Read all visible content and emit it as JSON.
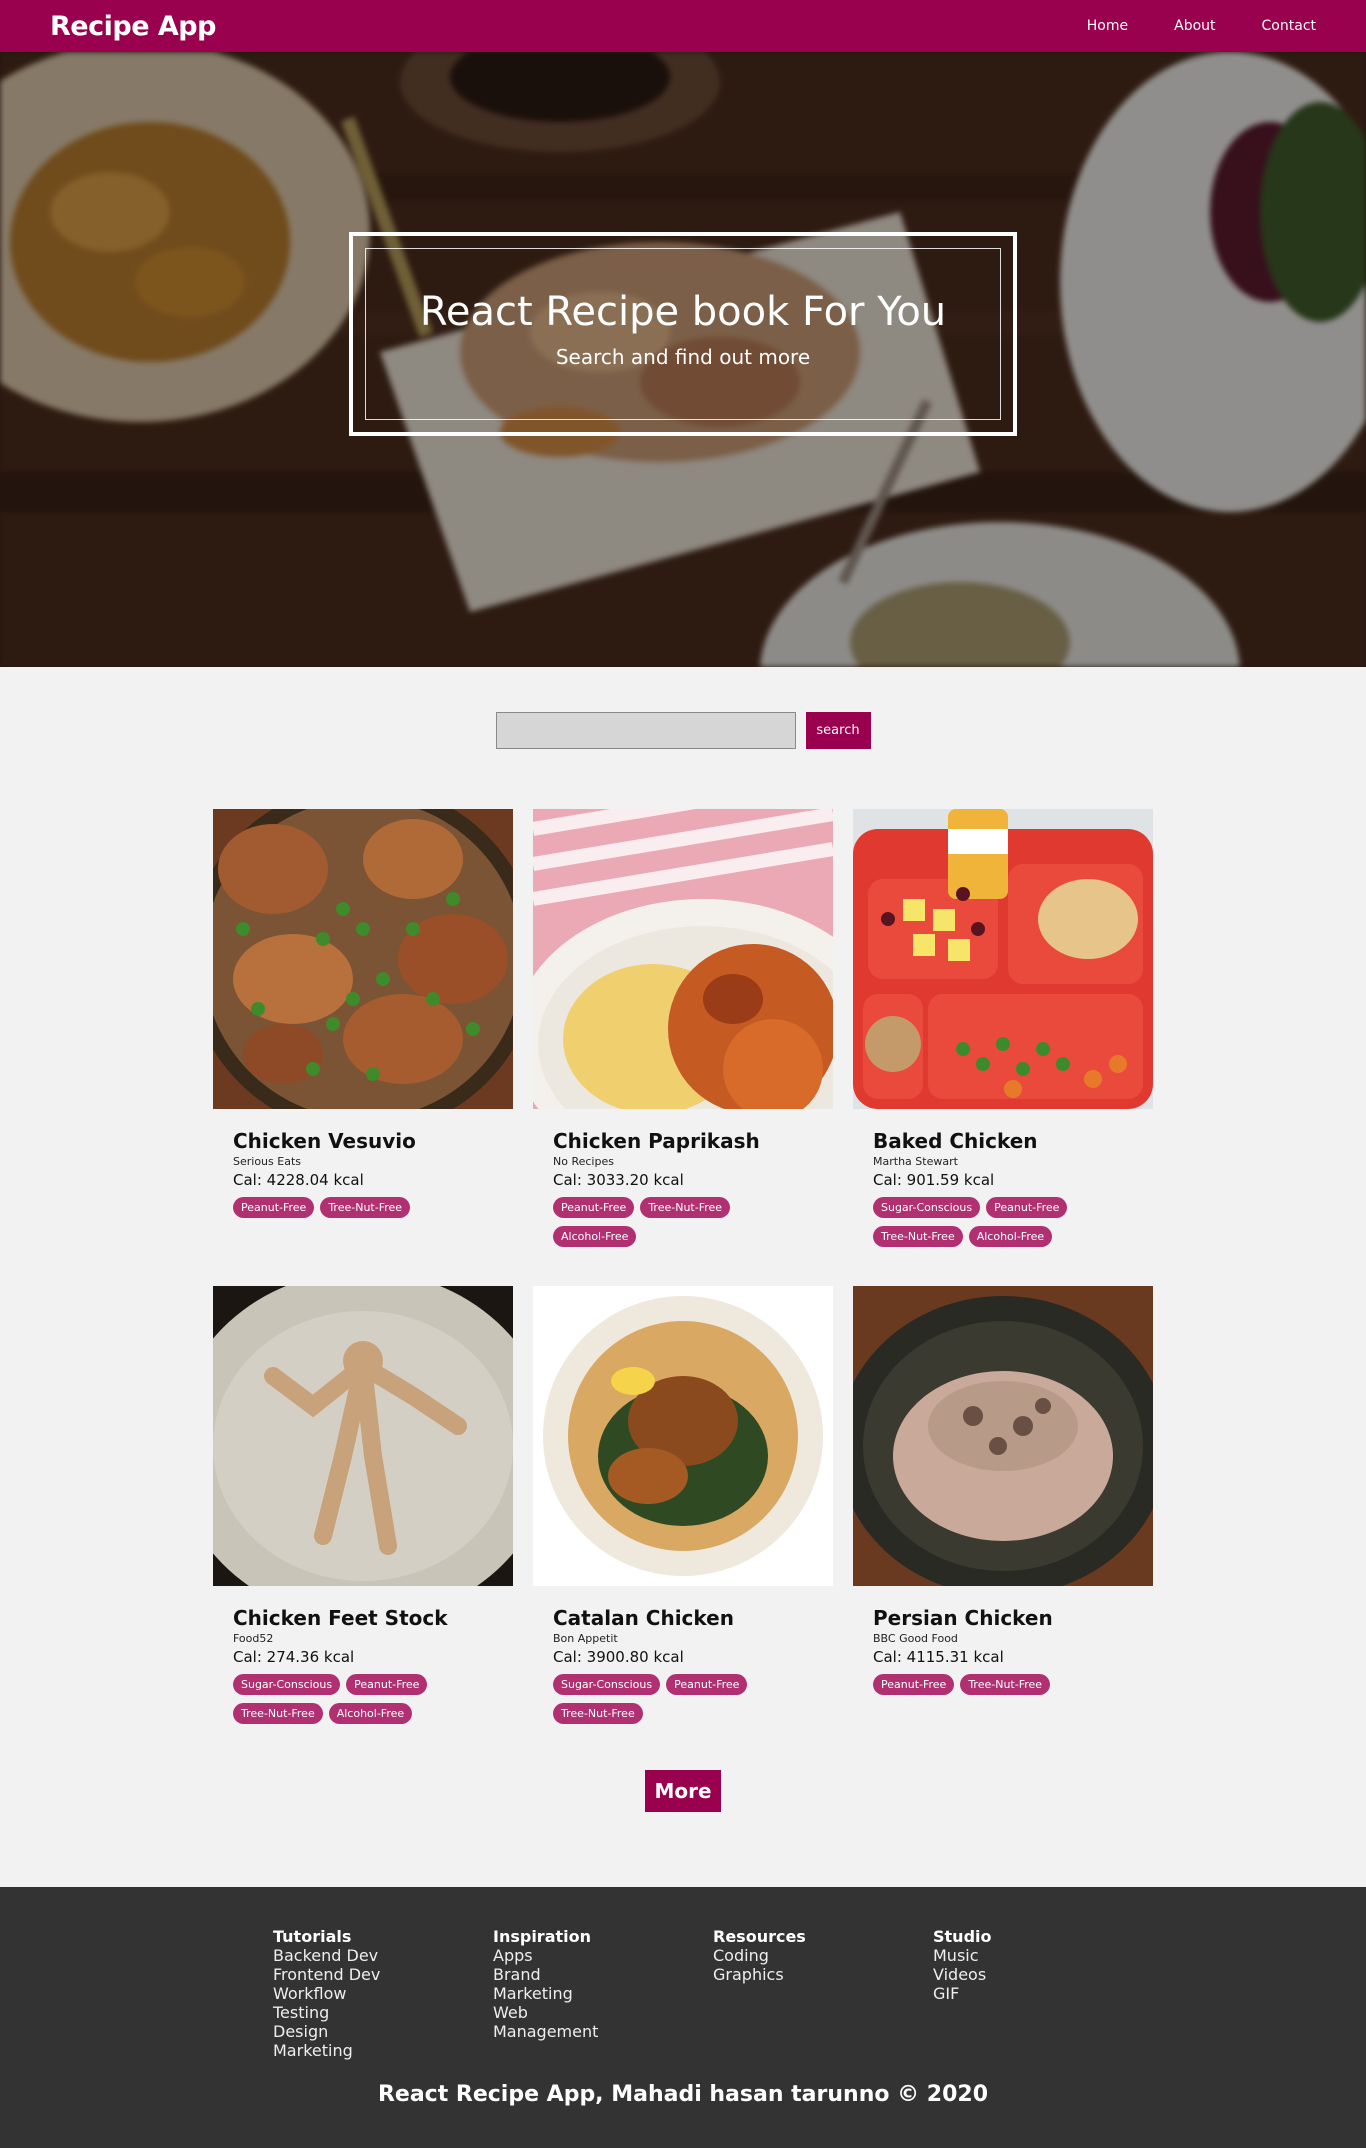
{
  "nav": {
    "brand": "Recipe App",
    "links": [
      "Home",
      "About",
      "Contact"
    ]
  },
  "hero": {
    "title": "React Recipe book For You",
    "subtitle": "Search and find out more"
  },
  "search": {
    "value": "",
    "placeholder": "",
    "button_label": "search"
  },
  "recipes": [
    {
      "title": "Chicken Vesuvio",
      "source": "Serious Eats",
      "calories": "Cal: 4228.04 kcal",
      "tags": [
        "Peanut-Free",
        "Tree-Nut-Free"
      ],
      "image": "chicken-vesuvio-photo"
    },
    {
      "title": "Chicken Paprikash",
      "source": "No Recipes",
      "calories": "Cal: 3033.20 kcal",
      "tags": [
        "Peanut-Free",
        "Tree-Nut-Free",
        "Alcohol-Free"
      ],
      "image": "chicken-paprikash-photo"
    },
    {
      "title": "Baked Chicken",
      "source": "Martha Stewart",
      "calories": "Cal: 901.59 kcal",
      "tags": [
        "Sugar-Conscious",
        "Peanut-Free",
        "Tree-Nut-Free",
        "Alcohol-Free"
      ],
      "image": "baked-chicken-photo"
    },
    {
      "title": "Chicken Feet Stock",
      "source": "Food52",
      "calories": "Cal: 274.36 kcal",
      "tags": [
        "Sugar-Conscious",
        "Peanut-Free",
        "Tree-Nut-Free",
        "Alcohol-Free"
      ],
      "image": "chicken-feet-stock-photo"
    },
    {
      "title": "Catalan Chicken",
      "source": "Bon Appetit",
      "calories": "Cal: 3900.80 kcal",
      "tags": [
        "Sugar-Conscious",
        "Peanut-Free",
        "Tree-Nut-Free"
      ],
      "image": "catalan-chicken-photo"
    },
    {
      "title": "Persian Chicken",
      "source": "BBC Good Food",
      "calories": "Cal: 4115.31 kcal",
      "tags": [
        "Peanut-Free",
        "Tree-Nut-Free"
      ],
      "image": "persian-chicken-photo"
    }
  ],
  "more_label": "More",
  "footer": {
    "columns": [
      {
        "title": "Tutorials",
        "items": [
          "Backend Dev",
          "Frontend Dev",
          "Workflow",
          "Testing",
          "Design",
          "Marketing"
        ]
      },
      {
        "title": "Inspiration",
        "items": [
          "Apps",
          "Brand",
          "Marketing",
          "Web",
          "Management"
        ]
      },
      {
        "title": "Resources",
        "items": [
          "Coding",
          "Graphics"
        ]
      },
      {
        "title": "Studio",
        "items": [
          "Music",
          "Videos",
          "GIF"
        ]
      }
    ],
    "copyright": "React Recipe App, Mahadi hasan tarunno © 2020"
  },
  "colors": {
    "brand": "#99004d",
    "tag": "#b03072",
    "footer": "#333333",
    "page": "#f2f2f2"
  }
}
